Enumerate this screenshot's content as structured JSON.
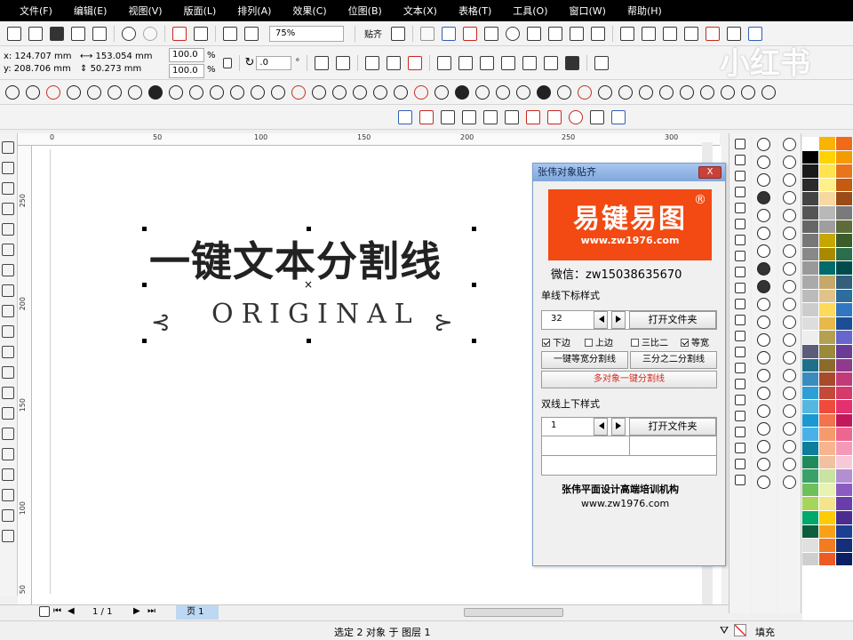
{
  "menu": [
    "文件(F)",
    "编辑(E)",
    "视图(V)",
    "版面(L)",
    "排列(A)",
    "效果(C)",
    "位图(B)",
    "文本(X)",
    "表格(T)",
    "工具(O)",
    "窗口(W)",
    "帮助(H)"
  ],
  "toolbar": {
    "zoom": "75%",
    "snap": "贴齐"
  },
  "props": {
    "x": "x: 124.707 mm",
    "y": "y: 208.706 mm",
    "width": "153.054 mm",
    "height": "50.273 mm",
    "scale_w": "100.0",
    "scale_h": "100.0",
    "pct": "%",
    "rotation": ".0",
    "degree": "°"
  },
  "ruler": {
    "top": [
      "0",
      "50",
      "100",
      "150",
      "200",
      "250",
      "300"
    ],
    "left": [
      "250",
      "200",
      "150",
      "100",
      "50"
    ]
  },
  "canvas": {
    "main_text": "一键文本分割线",
    "sub_text": "ORIGINAL",
    "left_ornament": "⊰",
    "right_ornament": "⊱"
  },
  "plugin": {
    "title": "张伟对象贴齐",
    "close": "X",
    "logo_big": "易键易图",
    "logo_url": "www.zw1976.com",
    "logo_reg": "®",
    "wechat": "微信：zw15038635670",
    "single_section": "单线下标样式",
    "single_value": "32",
    "open_folder": "打开文件夹",
    "chk_down": "下边",
    "chk_up": "上边",
    "chk_third": "三比二",
    "chk_equal": "等宽",
    "btn_equal": "一键等宽分割线",
    "btn_two_thirds": "三分之二分割线",
    "btn_multi": "多对象一键分割线",
    "double_section": "双线上下样式",
    "double_value": "1",
    "open_folder2": "打开文件夹",
    "org": "张伟平面设计高端培训机构",
    "url": "www.zw1976.com",
    "multi_color": "#d0281e"
  },
  "status": {
    "page_of": "1 / 1",
    "page_tab": "页 1",
    "selection": "选定 2 对象 于 图层 1",
    "fill": "填充"
  },
  "watermark": "小红书",
  "palette": [
    "#ffffff",
    "#f8b400",
    "#f06a1c",
    "#000000",
    "#ffd200",
    "#f39b00",
    "#1a1a1a",
    "#ffe44d",
    "#e8741c",
    "#2c2c2c",
    "#fff08a",
    "#c55a11",
    "#444444",
    "#f7d8a0",
    "#9b4b16",
    "#555555",
    "#b8b8b8",
    "#7a7a7a",
    "#666666",
    "#9e9e9e",
    "#5e6b3a",
    "#777777",
    "#c6a700",
    "#3c5c2c",
    "#888888",
    "#a88900",
    "#2b6e4b",
    "#999999",
    "#006b6b",
    "#004c4c",
    "#aaaaaa",
    "#c5a96a",
    "#355e7a",
    "#bbbbbb",
    "#e0c38a",
    "#2c6d9c",
    "#cccccc",
    "#ffd95a",
    "#3276c2",
    "#dddddd",
    "#e8b84b",
    "#1b4e96",
    "#eeeeee",
    "#b4a14f",
    "#6666cc",
    "#5a5e7a",
    "#9a8a3a",
    "#6b3c96",
    "#1f6f8b",
    "#8b6b2b",
    "#8e3b8c",
    "#3a8cbf",
    "#a84a2b",
    "#c33a7a",
    "#2d9fd6",
    "#c34a3a",
    "#d53a6a",
    "#55b7e0",
    "#ee4b3c",
    "#e5306e",
    "#1b97d2",
    "#f2734c",
    "#c2185b",
    "#4ab1e8",
    "#f59a6a",
    "#ee6690",
    "#0f7d9c",
    "#f7b48f",
    "#f49ab8",
    "#208a5c",
    "#f0c2a0",
    "#f7c9d8",
    "#38a169",
    "#c9e3a0",
    "#b28fd1",
    "#6fbf5a",
    "#e8f2b2",
    "#8a5cc2",
    "#a5d65a",
    "#f4e58c",
    "#6a3dad",
    "#00a86b",
    "#ffcb05",
    "#4b2d8f",
    "#0d5e3d",
    "#f7a11a",
    "#1c3f94",
    "#e0e0e0",
    "#f47b20",
    "#162f7a",
    "#cfcfcf",
    "#ee5a24",
    "#0a1f66"
  ]
}
